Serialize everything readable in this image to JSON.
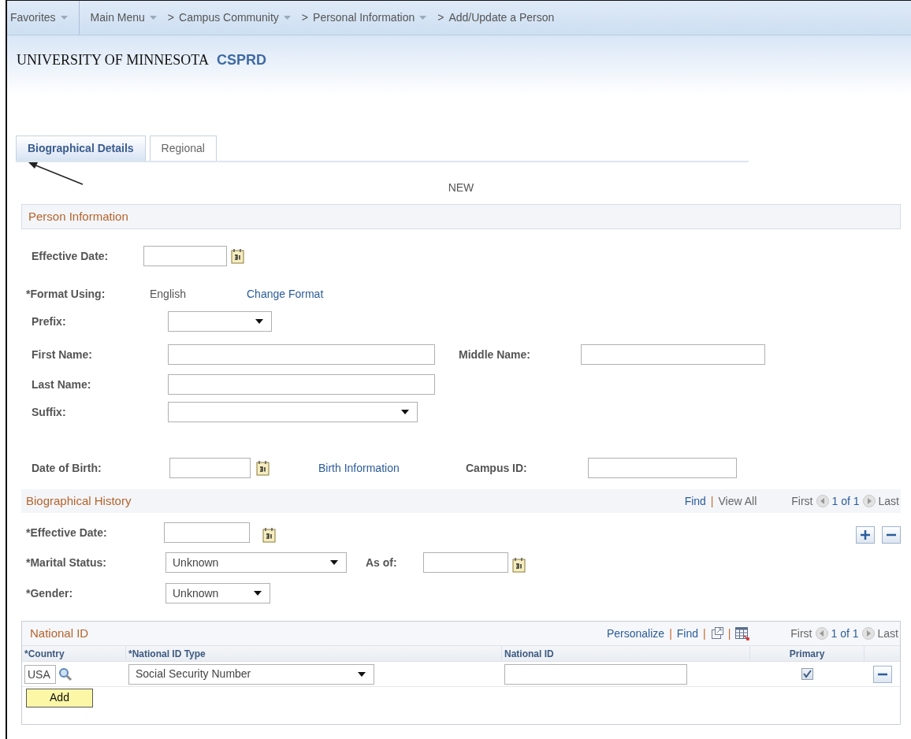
{
  "breadcrumb": [
    {
      "label": "Favorites",
      "menu": true
    },
    {
      "label": "Main Menu",
      "menu": true
    },
    {
      "separator": ">",
      "label": "Campus Community",
      "menu": true
    },
    {
      "separator": ">",
      "label": "Personal Information",
      "menu": true
    },
    {
      "separator": ">",
      "label": "Add/Update a Person",
      "menu": false
    }
  ],
  "header": {
    "institution": "UNIVERSITY OF MINNESOTA",
    "database": "CSPRD"
  },
  "tabs": [
    {
      "label": "Biographical Details",
      "selected": true
    },
    {
      "label": "Regional",
      "selected": false
    }
  ],
  "mode": "NEW",
  "person_information": {
    "title": "Person Information",
    "effective_date": {
      "label": "Effective Date:"
    },
    "format_using": {
      "label": "*Format Using:",
      "value": "English",
      "link": "Change Format"
    },
    "prefix": {
      "label": "Prefix:"
    },
    "first_name": {
      "label": "First Name:"
    },
    "middle_name": {
      "label": "Middle Name:"
    },
    "last_name": {
      "label": "Last Name:"
    },
    "suffix": {
      "label": "Suffix:"
    },
    "date_of_birth": {
      "label": "Date of Birth:"
    },
    "birth_information": {
      "link": "Birth Information"
    },
    "campus_id": {
      "label": "Campus ID:"
    }
  },
  "biographical_history": {
    "title": "Biographical History",
    "toolbar": [
      {
        "kind": "link",
        "label": "Find"
      },
      {
        "kind": "separator",
        "label": "|"
      },
      {
        "kind": "text",
        "label": "View All"
      }
    ],
    "pager": {
      "first": "First",
      "count": "1 of 1",
      "last": "Last"
    },
    "effective_date": {
      "label": "*Effective Date:"
    },
    "marital_status": {
      "label": "*Marital Status:",
      "value": "Unknown"
    },
    "as_of": {
      "label": "As of:"
    },
    "gender": {
      "label": "*Gender:",
      "value": "Unknown"
    }
  },
  "national_id": {
    "title": "National ID",
    "toolbar": [
      {
        "kind": "link",
        "label": "Personalize"
      },
      {
        "kind": "separator",
        "label": "|"
      },
      {
        "kind": "link",
        "label": "Find"
      },
      {
        "kind": "separator",
        "label": "|"
      },
      {
        "kind": "zoom"
      },
      {
        "kind": "separator",
        "label": "|"
      },
      {
        "kind": "download"
      }
    ],
    "pager": {
      "first": "First",
      "count": "1 of 1",
      "last": "Last"
    },
    "columns": [
      "*Country",
      "*National ID Type",
      "National ID",
      "Primary"
    ],
    "rows": [
      {
        "country": "USA",
        "id_type": "Social Security Number",
        "primary": true
      }
    ],
    "add_button": "Add"
  }
}
